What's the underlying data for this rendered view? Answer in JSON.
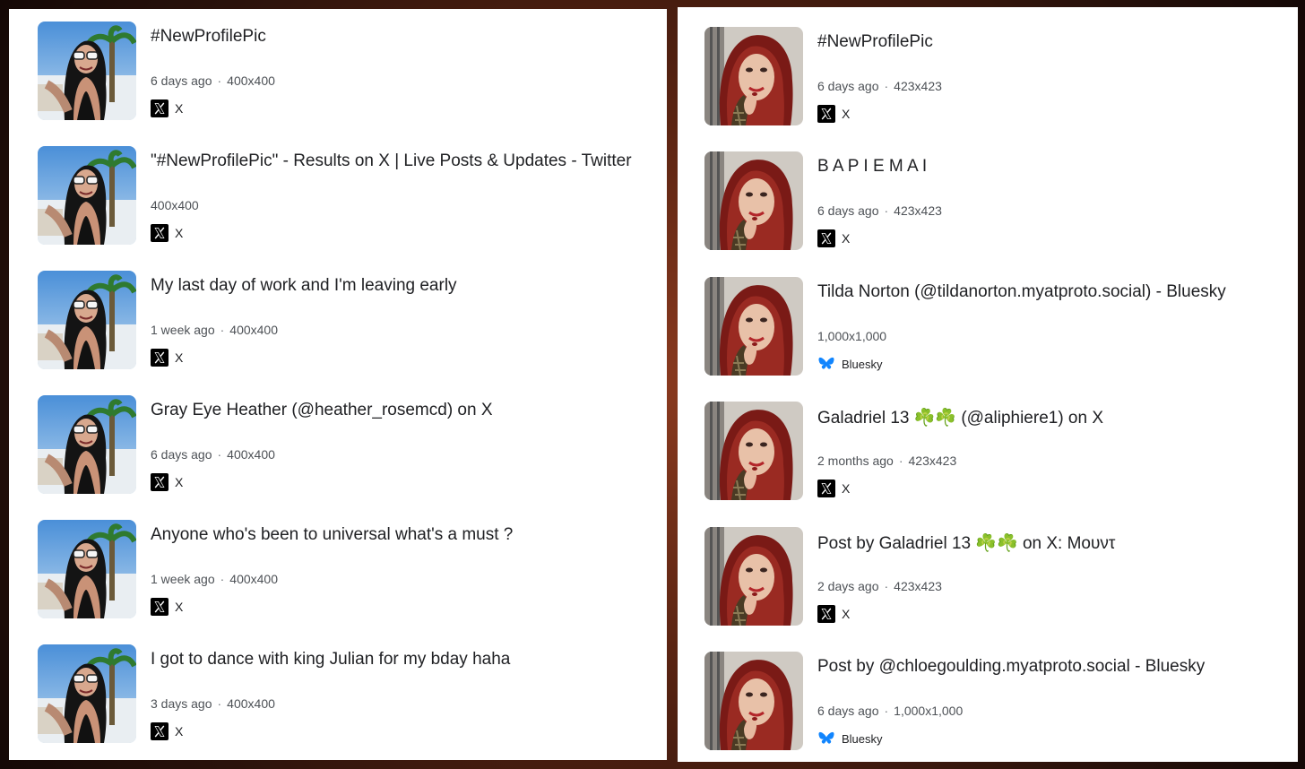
{
  "left_panel": {
    "results": [
      {
        "title": "#NewProfilePic",
        "age": "6 days ago",
        "size": "400x400",
        "source": "X",
        "source_icon": "x-logo-icon"
      },
      {
        "title": "\"#NewProfilePic\" - Results on X | Live Posts & Updates - Twitter",
        "age": "",
        "size": "400x400",
        "source": "X",
        "source_icon": "x-logo-icon"
      },
      {
        "title": "My last day of work and I'm leaving early",
        "age": "1 week ago",
        "size": "400x400",
        "source": "X",
        "source_icon": "x-logo-icon"
      },
      {
        "title": "Gray Eye Heather (@heather_rosemcd) on X",
        "age": "6 days ago",
        "size": "400x400",
        "source": "X",
        "source_icon": "x-logo-icon"
      },
      {
        "title": "Anyone who's been to universal what's a must ?",
        "age": "1 week ago",
        "size": "400x400",
        "source": "X",
        "source_icon": "x-logo-icon"
      },
      {
        "title": "I got to dance with king Julian for my bday haha",
        "age": "3 days ago",
        "size": "400x400",
        "source": "X",
        "source_icon": "x-logo-icon"
      }
    ]
  },
  "right_panel": {
    "results": [
      {
        "title": "#NewProfilePic",
        "age": "6 days ago",
        "size": "423x423",
        "source": "X",
        "source_icon": "x-logo-icon"
      },
      {
        "title": "B A P I E M A I",
        "age": "6 days ago",
        "size": "423x423",
        "source": "X",
        "source_icon": "x-logo-icon"
      },
      {
        "title": "Tilda Norton (@tildanorton.myatproto.social) - Bluesky",
        "age": "",
        "size": "1,000x1,000",
        "source": "Bluesky",
        "source_icon": "bluesky-butterfly-icon"
      },
      {
        "title": "Galadriel 13 ☘️☘️ (@aliphiere1) on X",
        "age": "2 months ago",
        "size": "423x423",
        "source": "X",
        "source_icon": "x-logo-icon"
      },
      {
        "title": "Post by Galadriel 13 ☘️☘️ on X: Mουντ",
        "age": "2 days ago",
        "size": "423x423",
        "source": "X",
        "source_icon": "x-logo-icon"
      },
      {
        "title": "Post by @chloegoulding.myatproto.social - Bluesky",
        "age": "6 days ago",
        "size": "1,000x1,000",
        "source": "Bluesky",
        "source_icon": "bluesky-butterfly-icon"
      }
    ]
  },
  "colors": {
    "x_logo": "#000000",
    "bluesky": "#1185fe",
    "title_text": "#202124",
    "meta_text": "#4d5156"
  }
}
